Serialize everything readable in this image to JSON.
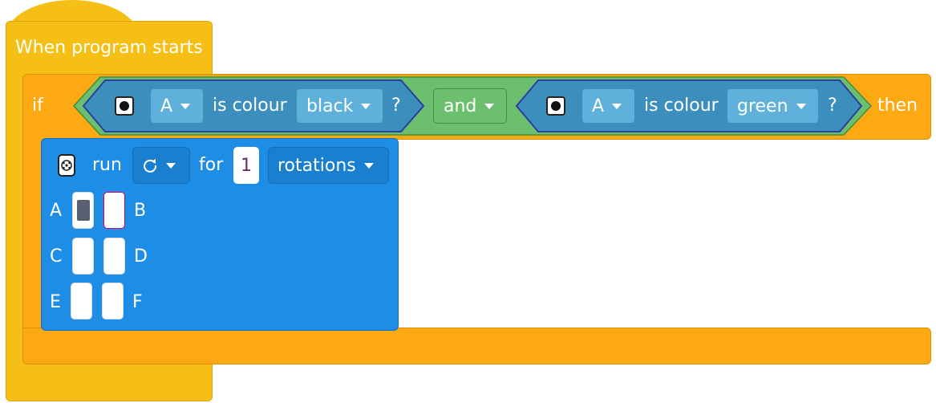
{
  "event_block": {
    "label": "When program starts"
  },
  "if_block": {
    "if_label": "if",
    "then_label": "then",
    "operator": {
      "label": "and"
    },
    "conditions": [
      {
        "port": "A",
        "text": "is colour",
        "colour": "black",
        "suffix": "?"
      },
      {
        "port": "A",
        "text": "is colour",
        "colour": "green",
        "suffix": "?"
      }
    ]
  },
  "motor_block": {
    "run_label": "run",
    "direction_icon": "clockwise-rotate-icon",
    "for_label": "for",
    "amount": "1",
    "unit": "rotations",
    "ports": [
      {
        "label": "A",
        "selected": true
      },
      {
        "label": "B",
        "selected": false
      },
      {
        "label": "C",
        "selected": false
      },
      {
        "label": "D",
        "selected": false
      },
      {
        "label": "E",
        "selected": false
      },
      {
        "label": "F",
        "selected": false
      }
    ]
  },
  "colors": {
    "events": "#f5bf15",
    "control": "#fda914",
    "operator": "#6bbf6e",
    "sensor": "#3c8fbd",
    "motor": "#1e8de6"
  }
}
